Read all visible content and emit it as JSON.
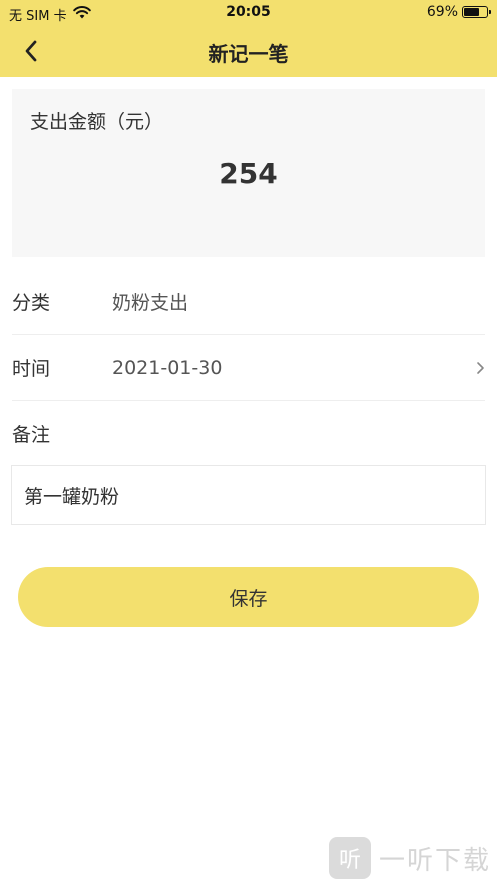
{
  "status_bar": {
    "carrier": "无 SIM 卡",
    "time": "20:05",
    "battery_percent": "69%",
    "battery_level": 0.69
  },
  "nav": {
    "title": "新记一笔",
    "back_icon": "chevron-left-icon"
  },
  "amount": {
    "label": "支出金额（元）",
    "value": "254"
  },
  "form": {
    "category_label": "分类",
    "category_value": "奶粉支出",
    "time_label": "时间",
    "time_value": "2021-01-30",
    "note_label": "备注",
    "note_value": "第一罐奶粉"
  },
  "actions": {
    "save_label": "保存"
  },
  "colors": {
    "accent": "#f3e06e",
    "card_bg": "#f7f7f7"
  },
  "watermark": {
    "logo_text": "听",
    "text": "一听下载"
  }
}
